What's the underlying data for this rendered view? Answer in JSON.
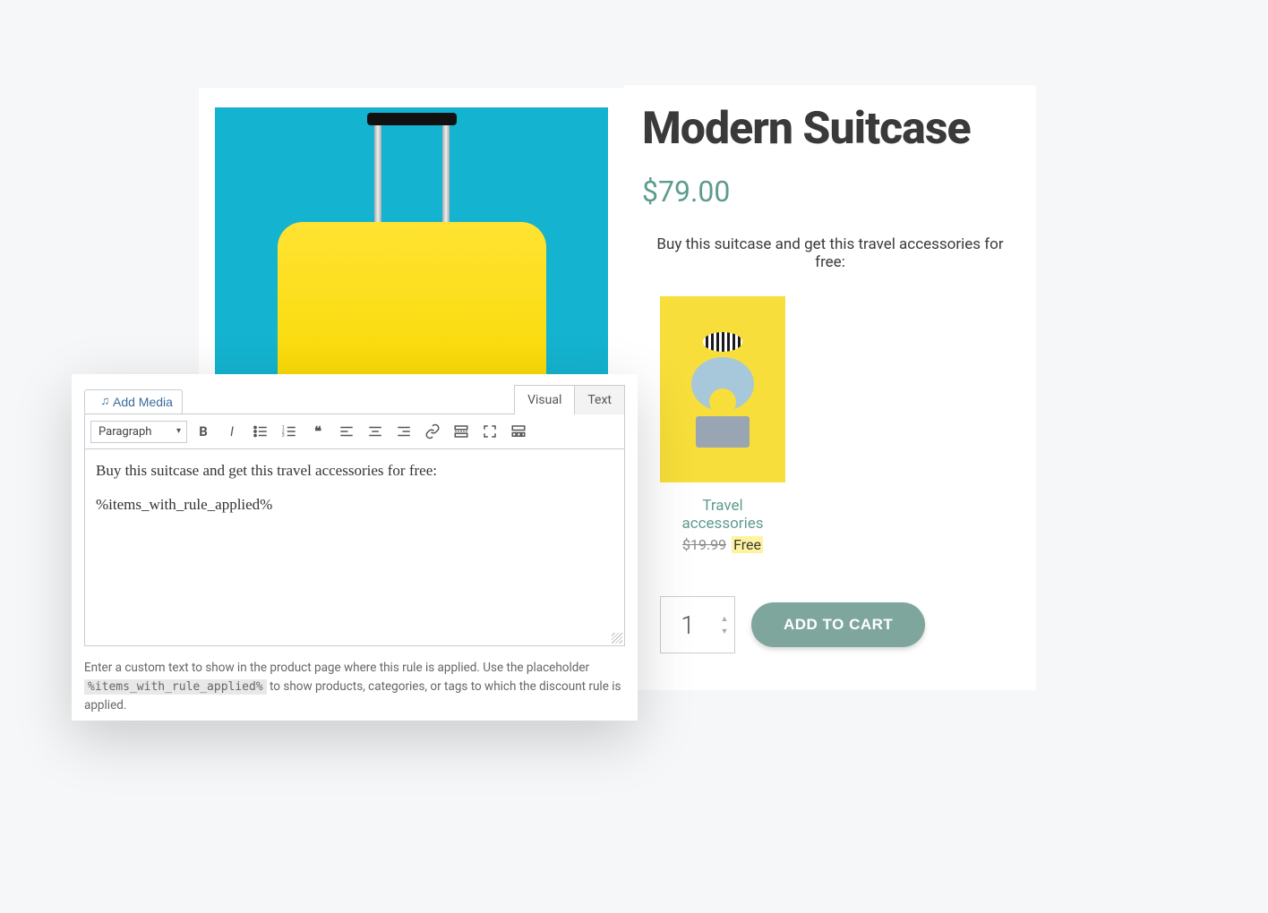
{
  "product": {
    "title": "Modern Suitcase",
    "price": "$79.00",
    "promo_text": "Buy this suitcase and get this travel accessories for free:",
    "accessory": {
      "name": "Travel accessories",
      "old_price": "$19.99",
      "free_label": "Free"
    },
    "quantity": "1",
    "add_to_cart_label": "ADD TO CART"
  },
  "editor": {
    "add_media_label": "Add Media",
    "tabs": {
      "visual": "Visual",
      "text": "Text"
    },
    "format_select": "Paragraph",
    "content_line1": "Buy this suitcase and get this travel accessories for free:",
    "content_line2": "%items_with_rule_applied%",
    "helper_pre": "Enter a custom text to show in the product page where this rule is applied. Use the placeholder ",
    "helper_code": "%items_with_rule_applied%",
    "helper_post": " to show products, categories, or tags to which the discount rule is applied."
  }
}
